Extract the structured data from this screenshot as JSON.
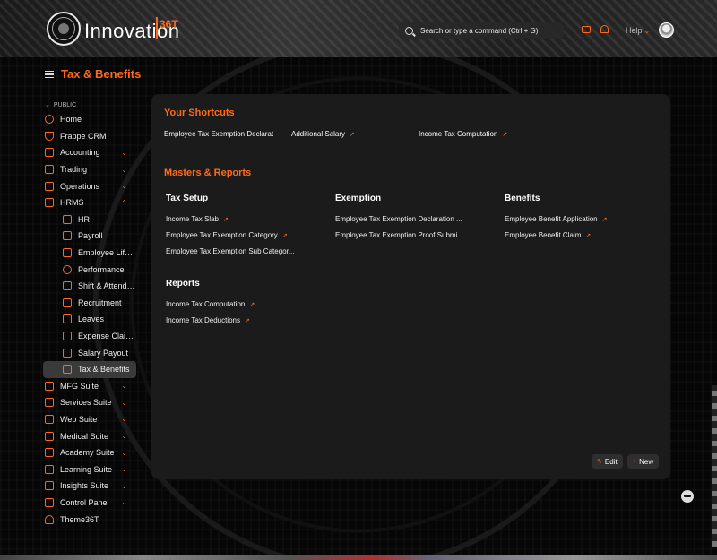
{
  "navbar": {
    "brand_name": "Innovation",
    "brand_suffix": "36T",
    "search_placeholder": "Search or type a command (Ctrl + G)",
    "help_label": "Help"
  },
  "page": {
    "title": "Tax & Benefits"
  },
  "sidebar": {
    "section_label": "PUBLIC",
    "items": [
      {
        "label": "Home",
        "icon": "home-icon"
      },
      {
        "label": "Frappe CRM",
        "icon": "funnel-icon"
      },
      {
        "label": "Accounting",
        "icon": "accounting-icon",
        "expandable": true
      },
      {
        "label": "Trading",
        "icon": "trading-icon",
        "expandable": true
      },
      {
        "label": "Operations",
        "icon": "operations-icon",
        "expandable": true
      },
      {
        "label": "HRMS",
        "icon": "hrms-icon",
        "expanded": true
      },
      {
        "label": "HR",
        "icon": "hr-icon",
        "sub": true
      },
      {
        "label": "Payroll",
        "icon": "payroll-icon",
        "sub": true
      },
      {
        "label": "Employee Lifecy...",
        "icon": "employee-lifecycle-icon",
        "sub": true
      },
      {
        "label": "Performance",
        "icon": "star-icon",
        "sub": true
      },
      {
        "label": "Shift & Attendance",
        "icon": "shift-icon",
        "sub": true
      },
      {
        "label": "Recruitment",
        "icon": "recruitment-icon",
        "sub": true
      },
      {
        "label": "Leaves",
        "icon": "leaves-icon",
        "sub": true
      },
      {
        "label": "Expense Claims",
        "icon": "expense-icon",
        "sub": true
      },
      {
        "label": "Salary Payout",
        "icon": "salary-icon",
        "sub": true
      },
      {
        "label": "Tax & Benefits",
        "icon": "tax-icon",
        "sub": true,
        "active": true
      },
      {
        "label": "MFG Suite",
        "icon": "mfg-icon",
        "expandable": true
      },
      {
        "label": "Services Suite",
        "icon": "services-icon",
        "expandable": true
      },
      {
        "label": "Web Suite",
        "icon": "web-icon",
        "expandable": true
      },
      {
        "label": "Medical Suite",
        "icon": "medical-icon",
        "expandable": true
      },
      {
        "label": "Academy Suite",
        "icon": "academy-icon",
        "expandable": true
      },
      {
        "label": "Learning Suite",
        "icon": "learning-icon",
        "expandable": true
      },
      {
        "label": "Insights Suite",
        "icon": "insights-icon",
        "expandable": true
      },
      {
        "label": "Control Panel",
        "icon": "control-panel-icon",
        "expandable": true
      },
      {
        "label": "Theme36T",
        "icon": "heart-icon"
      }
    ]
  },
  "shortcuts": {
    "heading": "Your Shortcuts",
    "items": [
      {
        "label": "Employee Tax Exemption Declarat"
      },
      {
        "label": "Additional Salary"
      },
      {
        "label": "Income Tax Computation"
      }
    ]
  },
  "masters": {
    "heading": "Masters & Reports",
    "tax_setup": {
      "title": "Tax Setup",
      "links": [
        "Income Tax Slab",
        "Employee Tax Exemption Category",
        "Employee Tax Exemption Sub Categor..."
      ]
    },
    "exemption": {
      "title": "Exemption",
      "links": [
        "Employee Tax Exemption Declaration ...",
        "Employee Tax Exemption Proof Submi..."
      ]
    },
    "benefits": {
      "title": "Benefits",
      "links": [
        "Employee Benefit Application",
        "Employee Benefit Claim"
      ]
    },
    "reports": {
      "title": "Reports",
      "links": [
        "Income Tax Computation",
        "Income Tax Deductions"
      ]
    }
  },
  "actions": {
    "edit_label": "Edit",
    "new_label": "New"
  },
  "colors": {
    "accent": "#ff6a1a",
    "card_bg": "#1c1c1c",
    "active_item_bg": "#3a3a3a"
  }
}
